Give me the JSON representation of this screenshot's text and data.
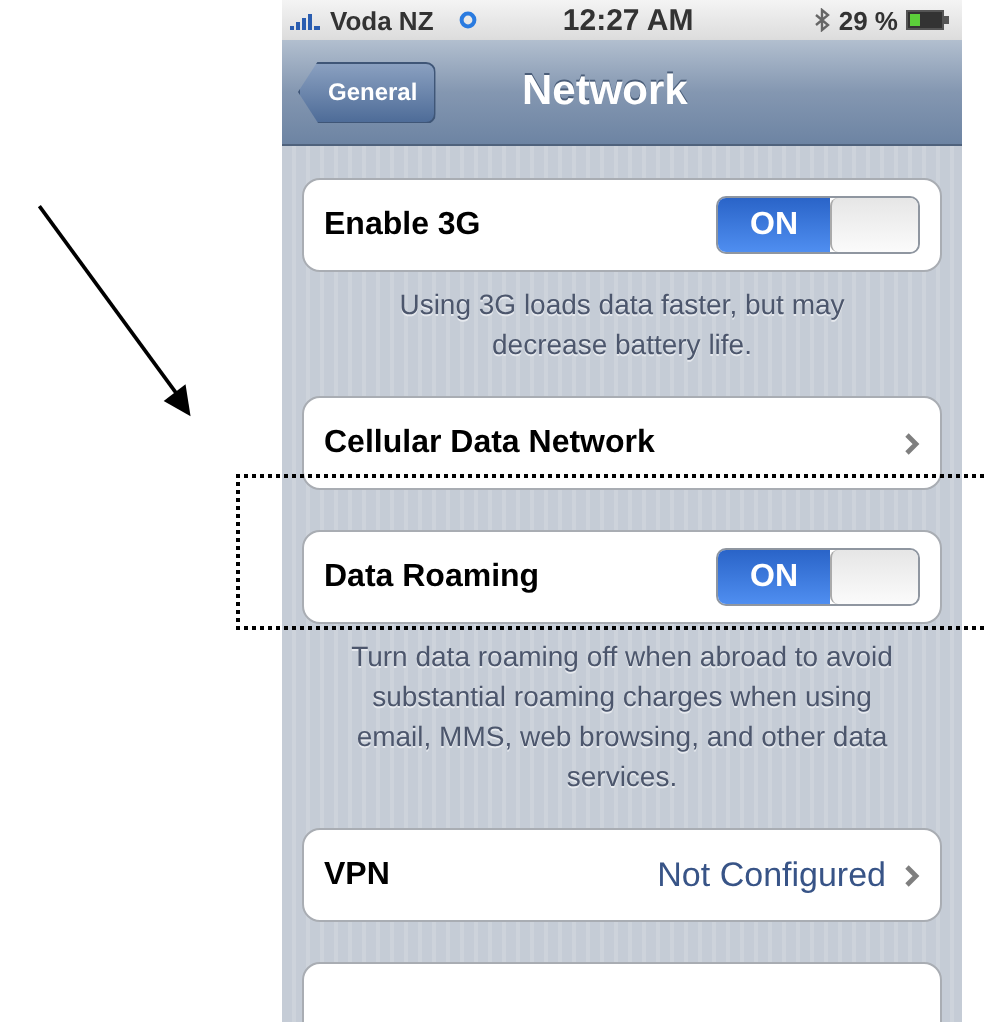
{
  "status_bar": {
    "carrier": "Voda NZ",
    "time": "12:27 AM",
    "battery": "29 %"
  },
  "nav_bar": {
    "back_button": "General",
    "title": "Network"
  },
  "sections": [
    {
      "rows": [
        {
          "kind": "toggle",
          "label": "Enable 3G",
          "on": true,
          "toggle_text": "ON"
        }
      ],
      "footer": "Using 3G loads data faster, but may decrease battery life."
    },
    {
      "rows": [
        {
          "kind": "disclosure",
          "label": "Cellular Data Network"
        }
      ]
    },
    {
      "rows": [
        {
          "kind": "toggle",
          "label": "Data Roaming",
          "on": true,
          "toggle_text": "ON"
        }
      ],
      "footer": "Turn data roaming off when abroad to avoid substantial roaming charges when using email, MMS, web browsing, and other data services."
    },
    {
      "rows": [
        {
          "kind": "disclosure",
          "label": "VPN",
          "value": "Not Configured"
        }
      ]
    },
    {
      "rows": [
        {
          "kind": "blank"
        }
      ]
    }
  ]
}
